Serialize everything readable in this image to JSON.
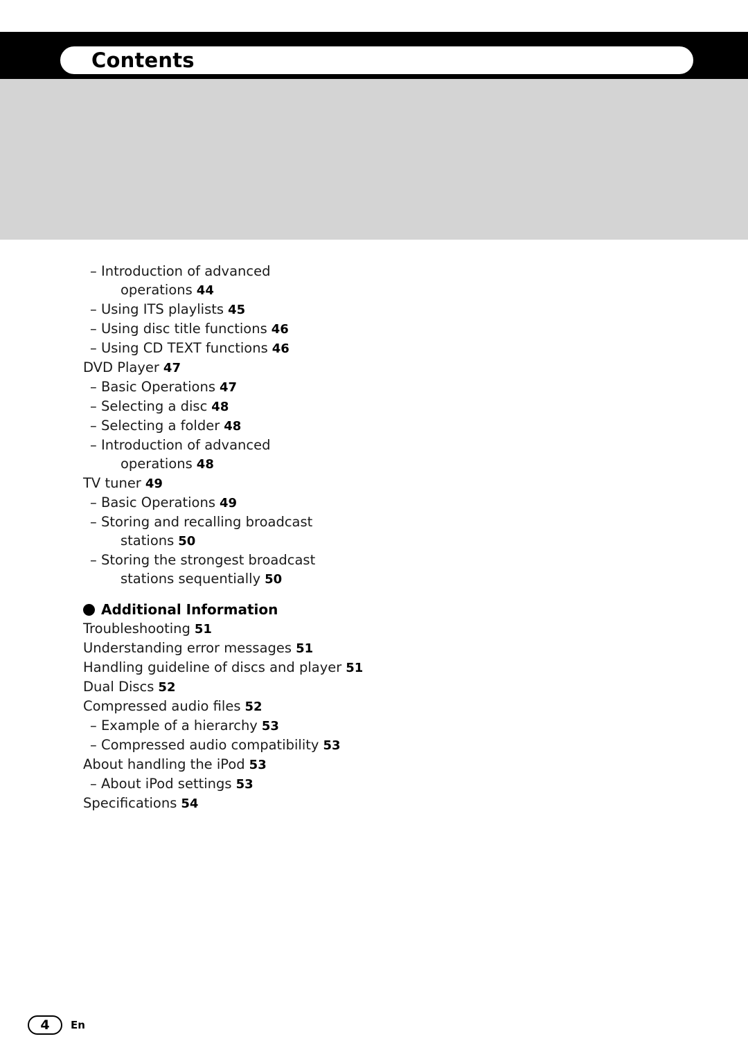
{
  "header": {
    "title": "Contents"
  },
  "toc": {
    "entries": [
      {
        "level": 2,
        "text": "Introduction of advanced",
        "page": ""
      },
      {
        "level": 3,
        "text": "operations",
        "page": "44"
      },
      {
        "level": 2,
        "text": "Using ITS playlists",
        "page": "45"
      },
      {
        "level": 2,
        "text": "Using disc title functions",
        "page": "46"
      },
      {
        "level": 2,
        "text": "Using CD TEXT functions",
        "page": "46"
      },
      {
        "level": 1,
        "text": "DVD Player",
        "page": "47"
      },
      {
        "level": 2,
        "text": "Basic Operations",
        "page": "47"
      },
      {
        "level": 2,
        "text": "Selecting a disc",
        "page": "48"
      },
      {
        "level": 2,
        "text": "Selecting a folder",
        "page": "48"
      },
      {
        "level": 2,
        "text": "Introduction of advanced",
        "page": ""
      },
      {
        "level": 3,
        "text": "operations",
        "page": "48"
      },
      {
        "level": 1,
        "text": "TV tuner",
        "page": "49"
      },
      {
        "level": 2,
        "text": "Basic Operations",
        "page": "49"
      },
      {
        "level": 2,
        "text": "Storing and recalling broadcast",
        "page": ""
      },
      {
        "level": 3,
        "text": "stations",
        "page": "50"
      },
      {
        "level": 2,
        "text": "Storing the strongest broadcast",
        "page": ""
      },
      {
        "level": 3,
        "text": "stations sequentially",
        "page": "50"
      }
    ],
    "section": {
      "title": "Additional Information",
      "entries": [
        {
          "level": 1,
          "text": "Troubleshooting",
          "page": "51"
        },
        {
          "level": 1,
          "text": "Understanding error messages",
          "page": "51"
        },
        {
          "level": 1,
          "text": "Handling guideline of discs and player",
          "page": "51"
        },
        {
          "level": 1,
          "text": "Dual Discs",
          "page": "52"
        },
        {
          "level": 1,
          "text": "Compressed audio files",
          "page": "52"
        },
        {
          "level": 2,
          "text": "Example of a hierarchy",
          "page": "53"
        },
        {
          "level": 2,
          "text": "Compressed audio compatibility",
          "page": "53"
        },
        {
          "level": 1,
          "text": "About handling the iPod",
          "page": "53"
        },
        {
          "level": 2,
          "text": "About iPod settings",
          "page": "53"
        },
        {
          "level": 1,
          "text": "Specifications",
          "page": "54"
        }
      ]
    }
  },
  "footer": {
    "page_number": "4",
    "language": "En"
  }
}
